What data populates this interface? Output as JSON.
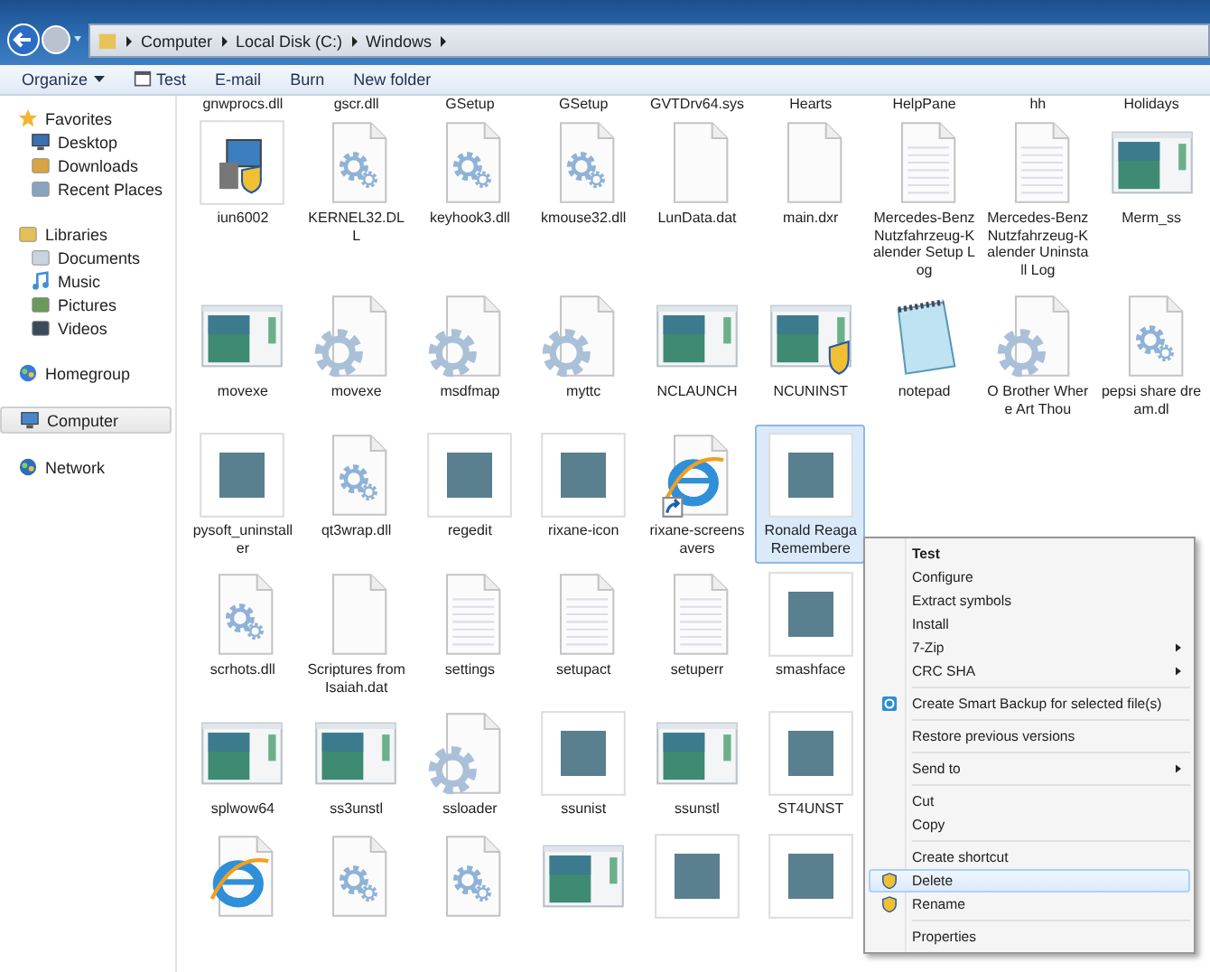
{
  "address_bar": {
    "crumbs": [
      "Computer",
      "Local Disk (C:)",
      "Windows"
    ]
  },
  "toolbar": [
    {
      "label": "Organize",
      "kind": "menu"
    },
    {
      "label": "Test",
      "kind": "icon"
    },
    {
      "label": "E-mail",
      "kind": "plain"
    },
    {
      "label": "Burn",
      "kind": "plain"
    },
    {
      "label": "New folder",
      "kind": "plain"
    }
  ],
  "sidebar": {
    "items": [
      {
        "label": "Favorites",
        "kind": "star",
        "selected": false,
        "children": [
          {
            "label": "Desktop",
            "kind": "desktop",
            "selected": false
          },
          {
            "label": "Downloads",
            "kind": "downloads",
            "selected": false
          },
          {
            "label": "Recent Places",
            "kind": "recent",
            "selected": false
          }
        ]
      },
      {
        "label": "Libraries",
        "kind": "libraries",
        "selected": false,
        "children": [
          {
            "label": "Documents",
            "kind": "documents",
            "selected": false
          },
          {
            "label": "Music",
            "kind": "music",
            "selected": false
          },
          {
            "label": "Pictures",
            "kind": "pictures",
            "selected": false
          },
          {
            "label": "Videos",
            "kind": "videos",
            "selected": false
          }
        ]
      },
      {
        "label": "Homegroup",
        "kind": "homegroup",
        "selected": false
      },
      {
        "label": "Computer",
        "kind": "computer",
        "selected": true
      },
      {
        "label": "Network",
        "kind": "network",
        "selected": false
      }
    ]
  },
  "previous_row_labels": [
    "gnwprocs.dll",
    "gscr.dll",
    "GSetup",
    "GSetup",
    "GVTDrv64.sys",
    "Hearts",
    "HelpPane",
    "hh",
    "Holidays"
  ],
  "file_rows": [
    [
      {
        "label": "iun6002",
        "kind": "installer",
        "selected": false
      },
      {
        "label": "KERNEL32.DLL",
        "kind": "gear",
        "selected": false
      },
      {
        "label": "keyhook3.dll",
        "kind": "gear",
        "selected": false
      },
      {
        "label": "kmouse32.dll",
        "kind": "gear",
        "selected": false
      },
      {
        "label": "LunData.dat",
        "kind": "blank",
        "selected": false
      },
      {
        "label": "main.dxr",
        "kind": "blank",
        "selected": false
      },
      {
        "label": "Mercedes-Benz Nutzfahrzeug-Kalender Setup Log",
        "kind": "lined",
        "selected": false
      },
      {
        "label": "Mercedes-Benz Nutzfahrzeug-Kalender Uninstall Log",
        "kind": "lined",
        "selected": false
      },
      {
        "label": "Merm_ss",
        "kind": "window",
        "selected": false
      }
    ],
    [
      {
        "label": "movexe",
        "kind": "window",
        "selected": false
      },
      {
        "label": "movexe",
        "kind": "gear-large",
        "selected": false
      },
      {
        "label": "msdfmap",
        "kind": "gear-large",
        "selected": false
      },
      {
        "label": "myttc",
        "kind": "gear-large",
        "selected": false
      },
      {
        "label": "NCLAUNCH",
        "kind": "window",
        "selected": false
      },
      {
        "label": "NCUNINST",
        "kind": "window-shield",
        "selected": false
      },
      {
        "label": "notepad",
        "kind": "notepad",
        "selected": false
      },
      {
        "label": "O Brother Where Art Thou",
        "kind": "gear-large",
        "selected": false
      },
      {
        "label": "pepsi share dream.dl",
        "kind": "gear",
        "selected": false
      }
    ],
    [
      {
        "label": "pysoft_uninstaller",
        "kind": "thumbnail",
        "selected": false
      },
      {
        "label": "qt3wrap.dll",
        "kind": "gear",
        "selected": false
      },
      {
        "label": "regedit",
        "kind": "thumbnail",
        "selected": false
      },
      {
        "label": "rixane-icon",
        "kind": "thumbnail",
        "selected": false
      },
      {
        "label": "rixane-screensavers",
        "kind": "browser-shortcut",
        "selected": false
      },
      {
        "label": "Ronald Reaga Remembere",
        "kind": "thumbnail",
        "selected": true
      }
    ],
    [
      {
        "label": "scrhots.dll",
        "kind": "gear",
        "selected": false
      },
      {
        "label": "Scriptures from Isaiah.dat",
        "kind": "blank",
        "selected": false
      },
      {
        "label": "settings",
        "kind": "lined",
        "selected": false
      },
      {
        "label": "setupact",
        "kind": "lined",
        "selected": false
      },
      {
        "label": "setuperr",
        "kind": "lined",
        "selected": false
      },
      {
        "label": "smashface",
        "kind": "thumbnail",
        "selected": false
      }
    ],
    [
      {
        "label": "splwow64",
        "kind": "window",
        "selected": false
      },
      {
        "label": "ss3unstl",
        "kind": "window",
        "selected": false
      },
      {
        "label": "ssloader",
        "kind": "gear-large",
        "selected": false
      },
      {
        "label": "ssunist",
        "kind": "thumbnail",
        "selected": false
      },
      {
        "label": "ssunstl",
        "kind": "window",
        "selected": false
      },
      {
        "label": "ST4UNST",
        "kind": "thumbnail",
        "selected": false
      }
    ],
    [
      {
        "kind": "browser",
        "selected": false
      },
      {
        "kind": "gear",
        "selected": false
      },
      {
        "kind": "gear",
        "selected": false
      },
      {
        "kind": "window",
        "selected": false
      },
      {
        "kind": "thumbnail",
        "selected": false
      },
      {
        "kind": "thumbnail",
        "selected": false
      }
    ]
  ],
  "context_menu": [
    {
      "kind": "item",
      "label": "Test",
      "default": true,
      "submenu": false,
      "selected": false
    },
    {
      "kind": "item",
      "label": "Configure",
      "default": false,
      "submenu": false,
      "selected": false
    },
    {
      "kind": "item",
      "label": "Extract symbols",
      "default": false,
      "submenu": false,
      "selected": false
    },
    {
      "kind": "item",
      "label": "Install",
      "default": false,
      "submenu": false,
      "selected": false
    },
    {
      "kind": "item",
      "label": "7-Zip",
      "default": false,
      "submenu": true,
      "selected": false
    },
    {
      "kind": "item",
      "label": "CRC SHA",
      "default": false,
      "submenu": true,
      "selected": false
    },
    {
      "kind": "separator"
    },
    {
      "kind": "backup-item",
      "label": "Create Smart Backup for selected file(s)",
      "default": false,
      "submenu": false,
      "selected": false
    },
    {
      "kind": "separator"
    },
    {
      "kind": "item",
      "label": "Restore previous versions",
      "default": false,
      "submenu": false,
      "selected": false
    },
    {
      "kind": "separator"
    },
    {
      "kind": "item",
      "label": "Send to",
      "default": false,
      "submenu": true,
      "selected": false
    },
    {
      "kind": "separator"
    },
    {
      "kind": "item",
      "label": "Cut",
      "default": false,
      "submenu": false,
      "selected": false
    },
    {
      "kind": "item",
      "label": "Copy",
      "default": false,
      "submenu": false,
      "selected": false
    },
    {
      "kind": "separator"
    },
    {
      "kind": "item",
      "label": "Create shortcut",
      "default": false,
      "submenu": false,
      "selected": false
    },
    {
      "kind": "shield-item",
      "label": "Delete",
      "default": false,
      "submenu": false,
      "selected": true
    },
    {
      "kind": "shield-item",
      "label": "Rename",
      "default": false,
      "submenu": false,
      "selected": false
    },
    {
      "kind": "separator"
    },
    {
      "kind": "item",
      "label": "Properties",
      "default": false,
      "submenu": false,
      "selected": false
    }
  ]
}
